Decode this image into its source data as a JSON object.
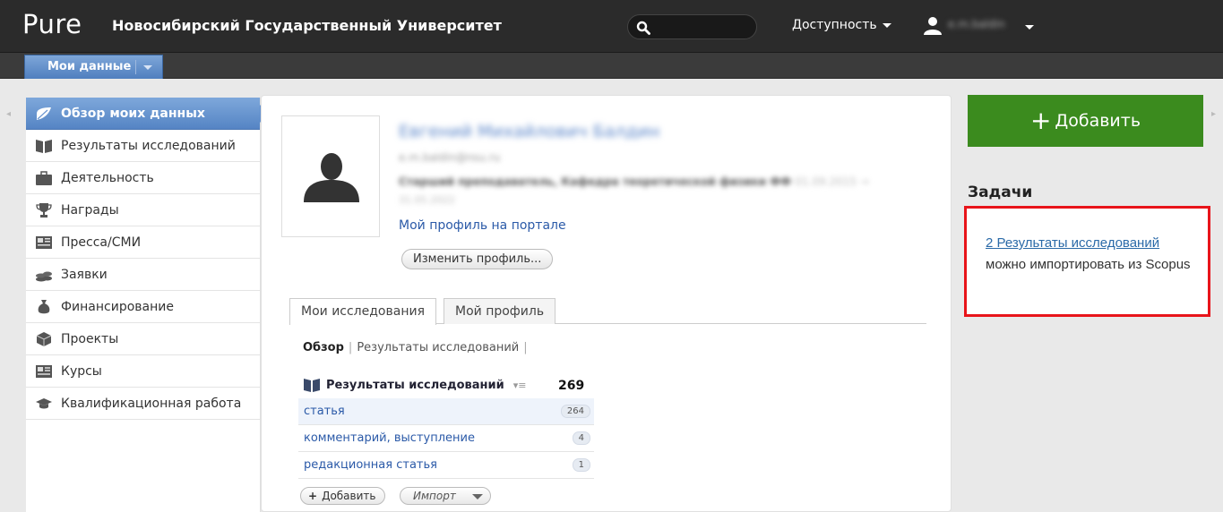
{
  "header": {
    "logo": "Pure",
    "university": "Новосибирский Государственный Университет",
    "accessibility": "Доступность",
    "user_name": "e.m.baldin"
  },
  "subnav": {
    "my_data": "Мои данные"
  },
  "sidebar": {
    "items": [
      {
        "label": "Обзор моих данных",
        "icon": "overview-icon"
      },
      {
        "label": "Результаты исследований",
        "icon": "book-icon"
      },
      {
        "label": "Деятельность",
        "icon": "briefcase-icon"
      },
      {
        "label": "Награды",
        "icon": "trophy-icon"
      },
      {
        "label": "Пресса/СМИ",
        "icon": "newspaper-icon"
      },
      {
        "label": "Заявки",
        "icon": "coins-icon"
      },
      {
        "label": "Финансирование",
        "icon": "money-bag-icon"
      },
      {
        "label": "Проекты",
        "icon": "cube-icon"
      },
      {
        "label": "Курсы",
        "icon": "course-icon"
      },
      {
        "label": "Квалификационная работа",
        "icon": "graduation-cap-icon"
      }
    ]
  },
  "profile": {
    "name": "Евгений Михайлович Балдин",
    "email": "e.m.baldin@nsu.ru",
    "position": "Старший преподаватель, Кафедра теоретической физики ФФ",
    "position_dates": "01.09.2015 →",
    "position_dates2": "31.05.2022",
    "portal_link": "Мой профиль на портале",
    "edit_button": "Изменить профиль..."
  },
  "tabs": [
    "Мои исследования",
    "Мой профиль"
  ],
  "breadcrumbs": {
    "current": "Обзор",
    "link": "Результаты исследований"
  },
  "research": {
    "title": "Результаты исследований",
    "total": "269",
    "rows": [
      {
        "label": "статья",
        "count": "264"
      },
      {
        "label": "комментарий, выступление",
        "count": "4"
      },
      {
        "label": "редакционная статья",
        "count": "1"
      }
    ],
    "add_label": "Добавить",
    "import_label": "Импорт"
  },
  "right": {
    "add_button": "Добавить",
    "tasks_title": "Задачи",
    "task_link": "2 Результаты исследований",
    "task_text": " можно импортировать из Scopus"
  },
  "colors": {
    "accent_green": "#3b8b1e",
    "highlight_red": "#e8141a",
    "link_blue": "#2b5aa8"
  }
}
